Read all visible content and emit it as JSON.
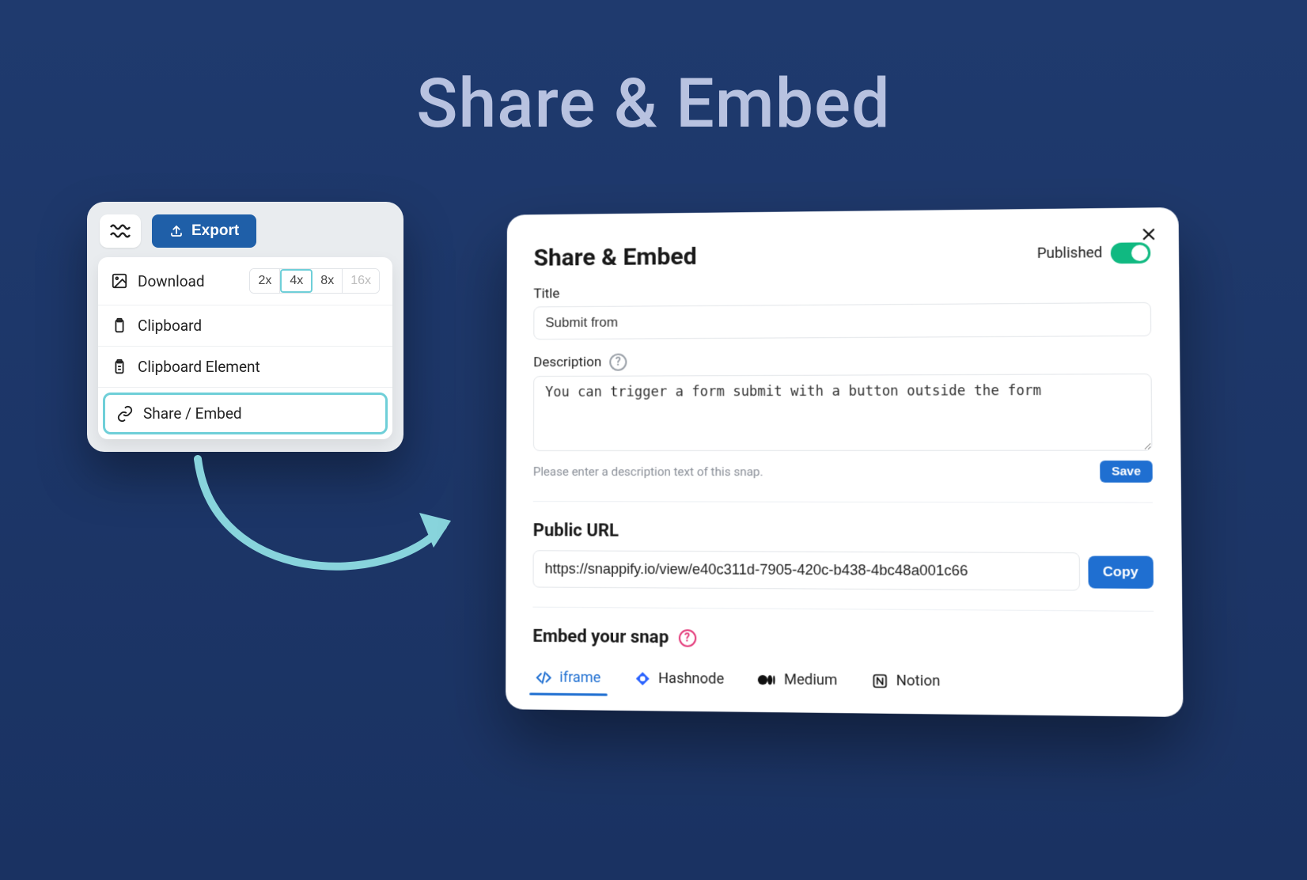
{
  "hero": {
    "title": "Share & Embed"
  },
  "export_panel": {
    "export_label": "Export",
    "rows": {
      "download": "Download",
      "clipboard": "Clipboard",
      "clipboard_element": "Clipboard Element",
      "share_embed": "Share / Embed"
    },
    "sizes": [
      "2x",
      "4x",
      "8x",
      "16x"
    ],
    "selected_size": "4x"
  },
  "modal": {
    "title": "Share & Embed",
    "published_label": "Published",
    "published": true,
    "title_field": {
      "label": "Title",
      "value": "Submit from"
    },
    "description_field": {
      "label": "Description",
      "value": "You can trigger a form submit with a button outside the form",
      "helper": "Please enter a description text of this snap."
    },
    "save_label": "Save",
    "public_url": {
      "label": "Public URL",
      "value": "https://snappify.io/view/e40c311d-7905-420c-b438-4bc48a001c66",
      "copy_label": "Copy"
    },
    "embed": {
      "heading": "Embed your snap",
      "tabs": {
        "iframe": "iframe",
        "hashnode": "Hashnode",
        "medium": "Medium",
        "notion": "Notion"
      }
    }
  }
}
